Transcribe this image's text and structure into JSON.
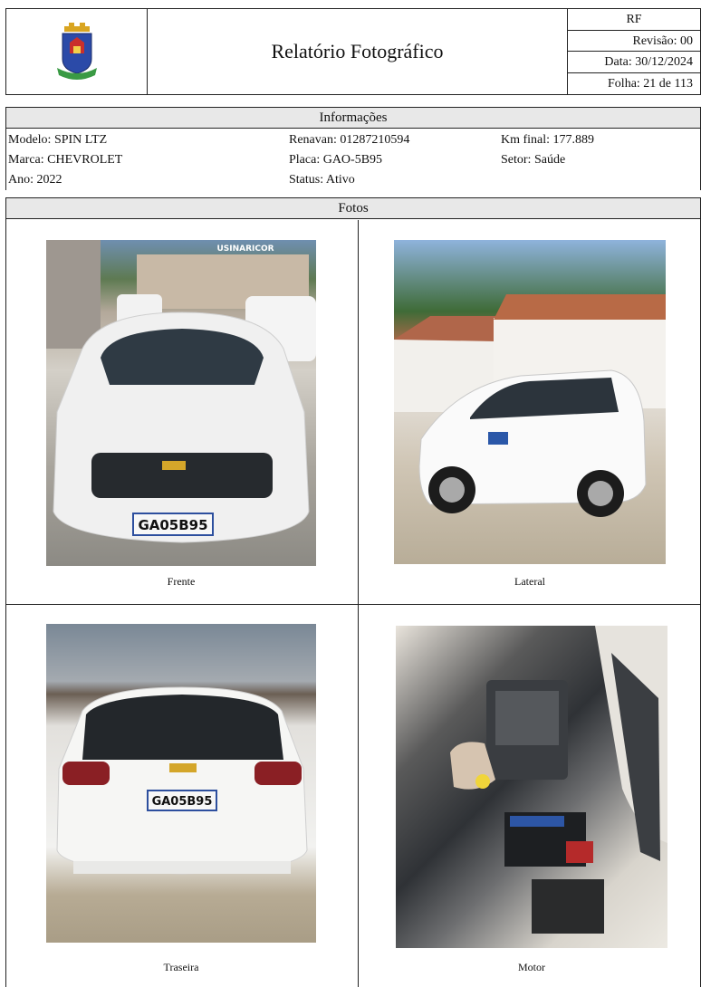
{
  "header": {
    "title": "Relatório Fotográfico",
    "code": "RF",
    "revisao": "Revisão: 00",
    "data": "Data: 30/12/2024",
    "folha": "Folha: 21 de 113",
    "logo_icon": "municipal-coat-of-arms"
  },
  "info": {
    "heading": "Informações",
    "modelo": "Modelo: SPIN LTZ",
    "marca": "Marca: CHEVROLET",
    "ano": "Ano: 2022",
    "renavan": "Renavan: 01287210594",
    "placa": "Placa: GAO-5B95",
    "status": "Status: Ativo",
    "km_final": "Km final: 177.889",
    "setor": "Setor: Saúde"
  },
  "fotos": {
    "heading": "Fotos",
    "items": [
      {
        "caption": "Frente",
        "plate": "GA05B95"
      },
      {
        "caption": "Lateral"
      },
      {
        "caption": "Traseira",
        "plate": "GA05B95"
      },
      {
        "caption": "Motor"
      }
    ]
  },
  "photo_text": {
    "sign": "USINARICOR"
  }
}
